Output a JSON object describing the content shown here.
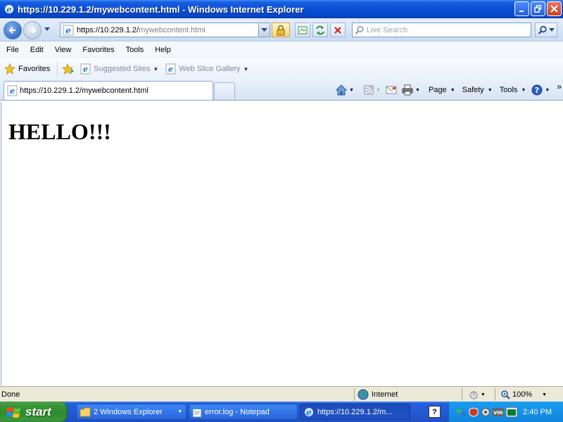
{
  "window": {
    "title": "https://10.229.1.2/mywebcontent.html - Windows Internet Explorer"
  },
  "address": {
    "url_host": "https://10.229.1.2/",
    "url_path": "mywebcontent.html"
  },
  "search": {
    "placeholder": "Live Search"
  },
  "menu": {
    "file": "File",
    "edit": "Edit",
    "view": "View",
    "favorites": "Favorites",
    "tools": "Tools",
    "help": "Help"
  },
  "favbar": {
    "favorites_label": "Favorites",
    "suggested_sites": "Suggested Sites",
    "web_slice_gallery": "Web Slice Gallery"
  },
  "tab": {
    "label": "https://10.229.1.2/mywebcontent.html"
  },
  "commands": {
    "page": "Page",
    "safety": "Safety",
    "tools": "Tools"
  },
  "content": {
    "heading": "HELLO!!!"
  },
  "status": {
    "text": "Done",
    "zone": "Internet",
    "zoom": "100%"
  },
  "taskbar": {
    "start_label": "start",
    "tasks": [
      {
        "label": "2 Windows Explorer"
      },
      {
        "label": "error.log - Notepad"
      },
      {
        "label": "https://10.229.1.2/m..."
      }
    ],
    "help_label": "?",
    "clock": "2:40 PM"
  },
  "colors": {
    "titlebar": "#0a4fd6",
    "taskbar": "#245edb",
    "start": "#379637",
    "tray": "#0f86dd"
  }
}
